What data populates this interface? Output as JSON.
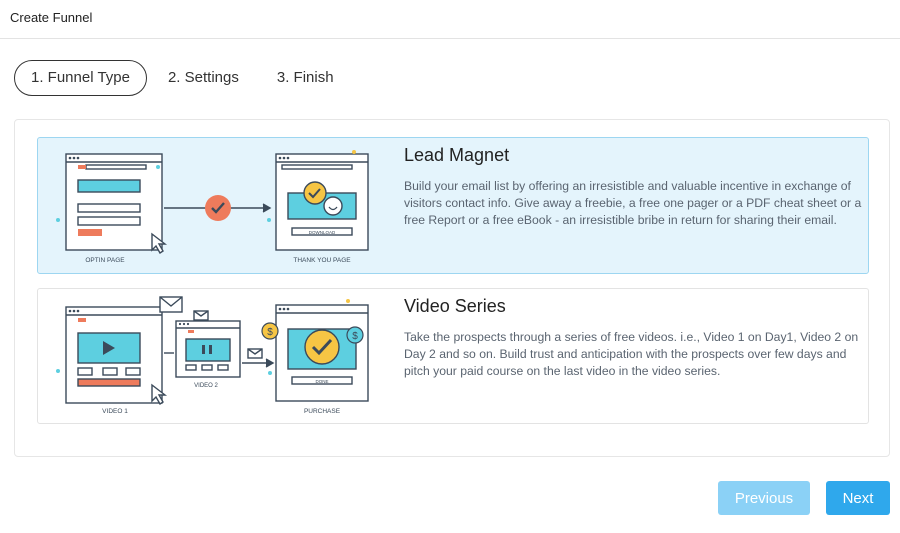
{
  "header": {
    "title": "Create Funnel"
  },
  "steps": [
    {
      "label": "1. Funnel Type",
      "active": true
    },
    {
      "label": "2. Settings",
      "active": false
    },
    {
      "label": "3. Finish",
      "active": false
    }
  ],
  "cards": [
    {
      "title": "Lead Magnet",
      "description": "Build your email list by offering an irresistible and valuable incentive in exchange of visitors contact info. Give away a freebie, a free one pager or a PDF cheat sheet or a free Report or a free eBook - an irresistible bribe in return for sharing their email.",
      "selected": true,
      "illustration": {
        "left_caption": "OPTIN PAGE",
        "right_caption": "THANK YOU PAGE",
        "button_caption": "DOWNLOAD"
      }
    },
    {
      "title": "Video Series",
      "description": "Take the prospects through a series of free videos. i.e., Video 1 on Day1, Video 2 on Day 2 and so on. Build trust and anticipation with the prospects over few days and pitch your paid course on the last video in the video series.",
      "selected": false,
      "illustration": {
        "caption_1": "VIDEO 1",
        "caption_2": "VIDEO 2",
        "caption_3": "PURCHASE",
        "button_caption": "DONE"
      }
    }
  ],
  "footer": {
    "previous_label": "Previous",
    "next_label": "Next"
  },
  "colors": {
    "accent": "#2fa8ec",
    "accent_light": "#8bd1f6",
    "selected_bg": "#e4f4fc",
    "screen_teal": "#5dcfe0",
    "orange": "#ee7b5c",
    "yellow": "#f6c544"
  }
}
